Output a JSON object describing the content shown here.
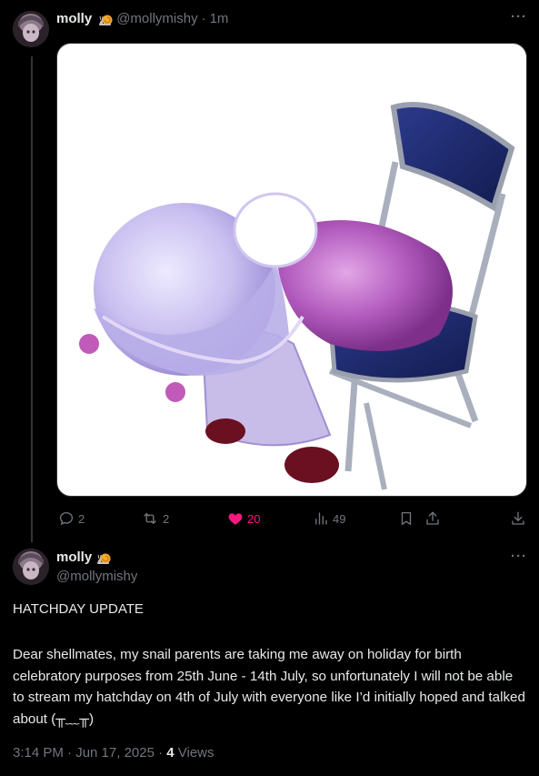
{
  "reply_tweet": {
    "author_name": "molly",
    "author_handle": "@mollymishy",
    "separator": "·",
    "time_ago": "1m",
    "more_label": "···",
    "actions": {
      "replies": "2",
      "reposts": "2",
      "likes": "20",
      "views": "49"
    },
    "accent_like_color": "#f91880"
  },
  "main_tweet": {
    "author_name": "molly",
    "author_handle": "@mollymishy",
    "more_label": "···",
    "title": "HATCHDAY UPDATE",
    "body": "Dear shellmates, my snail parents are taking me away on holiday for birth celebratory purposes from 25th June - 14th July, so unfortunately I will not be able to stream my hatchday on 4th of July with everyone like I’d initially hoped and talked about (╥﹏╥)",
    "timestamp": "3:14 PM · Jun 17, 2025 · ",
    "views_count": "4",
    "views_label": " Views"
  },
  "icons": {
    "snail": "snail-emoji-icon",
    "reply": "reply-icon",
    "repost": "repost-icon",
    "like": "heart-icon",
    "views": "views-icon",
    "bookmark": "bookmark-icon",
    "share": "share-icon",
    "download": "download-icon"
  }
}
